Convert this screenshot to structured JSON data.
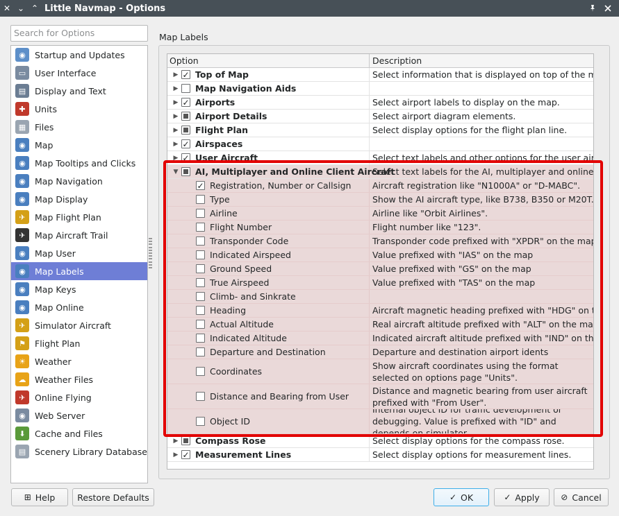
{
  "window": {
    "title": "Little Navmap - Options",
    "close_glyph": "✕",
    "menu_glyph": "⌄",
    "keep_glyph": "⌃",
    "pin_glyph": "📌",
    "max_glyph": "✕"
  },
  "search": {
    "placeholder": "Search for Options"
  },
  "pages": [
    {
      "label": "Startup and Updates",
      "icon": "globe-icon",
      "color": "#5d8fc9",
      "glyph": "◉"
    },
    {
      "label": "User Interface",
      "icon": "window-icon",
      "color": "#7a8ba0",
      "glyph": "▭"
    },
    {
      "label": "Display and Text",
      "icon": "display-icon",
      "color": "#6b7d93",
      "glyph": "▤"
    },
    {
      "label": "Units",
      "icon": "units-icon",
      "color": "#c0392b",
      "glyph": "✚"
    },
    {
      "label": "Files",
      "icon": "files-icon",
      "color": "#9aa5b1",
      "glyph": "▦"
    },
    {
      "label": "Map",
      "icon": "map-icon",
      "color": "#4a7fbf",
      "glyph": "◉"
    },
    {
      "label": "Map Tooltips and Clicks",
      "icon": "map-tooltip-icon",
      "color": "#4a7fbf",
      "glyph": "◉"
    },
    {
      "label": "Map Navigation",
      "icon": "map-navigation-icon",
      "color": "#4a7fbf",
      "glyph": "◉"
    },
    {
      "label": "Map Display",
      "icon": "map-display-icon",
      "color": "#4a7fbf",
      "glyph": "◉"
    },
    {
      "label": "Map Flight Plan",
      "icon": "map-flightplan-icon",
      "color": "#d4a017",
      "glyph": "✈"
    },
    {
      "label": "Map Aircraft Trail",
      "icon": "aircraft-trail-icon",
      "color": "#333333",
      "glyph": "✈"
    },
    {
      "label": "Map User",
      "icon": "map-user-icon",
      "color": "#4a7fbf",
      "glyph": "◉"
    },
    {
      "label": "Map Labels",
      "icon": "map-labels-icon",
      "color": "#4a7fbf",
      "glyph": "◉"
    },
    {
      "label": "Map Keys",
      "icon": "map-keys-icon",
      "color": "#4a7fbf",
      "glyph": "◉"
    },
    {
      "label": "Map Online",
      "icon": "map-online-icon",
      "color": "#4a7fbf",
      "glyph": "◉"
    },
    {
      "label": "Simulator Aircraft",
      "icon": "simulator-aircraft-icon",
      "color": "#d4a017",
      "glyph": "✈"
    },
    {
      "label": "Flight Plan",
      "icon": "flight-plan-icon",
      "color": "#d4a017",
      "glyph": "⚑"
    },
    {
      "label": "Weather",
      "icon": "weather-icon",
      "color": "#e8a317",
      "glyph": "☀"
    },
    {
      "label": "Weather Files",
      "icon": "weather-files-icon",
      "color": "#e8a317",
      "glyph": "☁"
    },
    {
      "label": "Online Flying",
      "icon": "online-flying-icon",
      "color": "#c0392b",
      "glyph": "✈"
    },
    {
      "label": "Web Server",
      "icon": "web-server-icon",
      "color": "#7a8ba0",
      "glyph": "◉"
    },
    {
      "label": "Cache and Files",
      "icon": "cache-icon",
      "color": "#5a9a3a",
      "glyph": "⬇"
    },
    {
      "label": "Scenery Library Database",
      "icon": "database-icon",
      "color": "#9aa5b1",
      "glyph": "▤"
    }
  ],
  "selected_page_index": 12,
  "group": {
    "title": "Map Labels"
  },
  "tree": {
    "headers": {
      "option": "Option",
      "description": "Description"
    },
    "top_rows": [
      {
        "label": "Top of Map",
        "desc": "Select information that is displayed on top of the map.",
        "state": "checked"
      },
      {
        "label": "Map Navigation Aids",
        "desc": "",
        "state": "unchecked"
      },
      {
        "label": "Airports",
        "desc": "Select airport labels to display on the map.",
        "state": "checked"
      },
      {
        "label": "Airport Details",
        "desc": "Select airport diagram elements.",
        "state": "partial"
      },
      {
        "label": "Flight Plan",
        "desc": "Select display options for the flight plan line.",
        "state": "partial"
      },
      {
        "label": "Airspaces",
        "desc": "",
        "state": "checked"
      },
      {
        "label": "User Aircraft",
        "desc": "Select text labels and other options for the user aircraft.",
        "state": "checked"
      }
    ],
    "group_row": {
      "label": "AI, Multiplayer and Online Client Aircraft",
      "desc": "Select text labels for the AI, multiplayer and online clie...",
      "state": "partial"
    },
    "sub_rows": [
      {
        "label": "Registration, Number or Callsign",
        "desc": "Aircraft registration like \"N1000A\" or \"D-MABC\".",
        "state": "checked"
      },
      {
        "label": "Type",
        "desc": "Show the AI aircraft type, like B738, B350 or M20T.",
        "state": "unchecked"
      },
      {
        "label": "Airline",
        "desc": "Airline like \"Orbit Airlines\".",
        "state": "unchecked"
      },
      {
        "label": "Flight Number",
        "desc": "Flight number like \"123\".",
        "state": "unchecked"
      },
      {
        "label": "Transponder Code",
        "desc": "Transponder code prefixed with \"XPDR\" on the map",
        "state": "unchecked"
      },
      {
        "label": "Indicated Airspeed",
        "desc": "Value prefixed with \"IAS\" on the map",
        "state": "unchecked"
      },
      {
        "label": "Ground Speed",
        "desc": "Value prefixed with \"GS\" on the map",
        "state": "unchecked"
      },
      {
        "label": "True Airspeed",
        "desc": "Value prefixed with \"TAS\" on the map",
        "state": "unchecked"
      },
      {
        "label": "Climb- and Sinkrate",
        "desc": "",
        "state": "unchecked"
      },
      {
        "label": "Heading",
        "desc": "Aircraft magnetic heading prefixed with \"HDG\" on the ...",
        "state": "unchecked"
      },
      {
        "label": "Actual Altitude",
        "desc": "Real aircraft altitude prefixed with \"ALT\" on the map",
        "state": "unchecked"
      },
      {
        "label": "Indicated Altitude",
        "desc": "Indicated aircraft altitude prefixed with \"IND\" on the ...",
        "state": "unchecked"
      },
      {
        "label": "Departure and Destination",
        "desc": "Departure and destination airport idents",
        "state": "unchecked"
      },
      {
        "label": "Coordinates",
        "desc": "Show aircraft coordinates using the format selected on options page \"Units\".",
        "state": "unchecked",
        "tall": true
      },
      {
        "label": "Distance and Bearing from User",
        "desc": "Distance and magnetic bearing from user aircraft prefixed with \"From User\".",
        "state": "unchecked",
        "tall": true
      },
      {
        "label": "Object ID",
        "desc": "Internal object ID for traffic development or debugging. Value is prefixed with \"ID\" and depends on simulator.",
        "state": "unchecked",
        "tall": true
      }
    ],
    "bottom_rows": [
      {
        "label": "Compass Rose",
        "desc": "Select display options for the compass rose.",
        "state": "partial"
      },
      {
        "label": "Measurement Lines",
        "desc": "Select display options for measurement lines.",
        "state": "checked"
      }
    ]
  },
  "buttons": {
    "help": "Help",
    "restore": "Restore Defaults",
    "ok": "OK",
    "apply": "Apply",
    "cancel": "Cancel"
  },
  "icons": {
    "help": "⊞",
    "ok": "✓",
    "apply": "✓",
    "cancel": "⊘",
    "check": "✓",
    "expand": "▶",
    "collapse": "▼"
  },
  "colors": {
    "highlight": "#e20000",
    "selected": "#6e7ed6"
  }
}
